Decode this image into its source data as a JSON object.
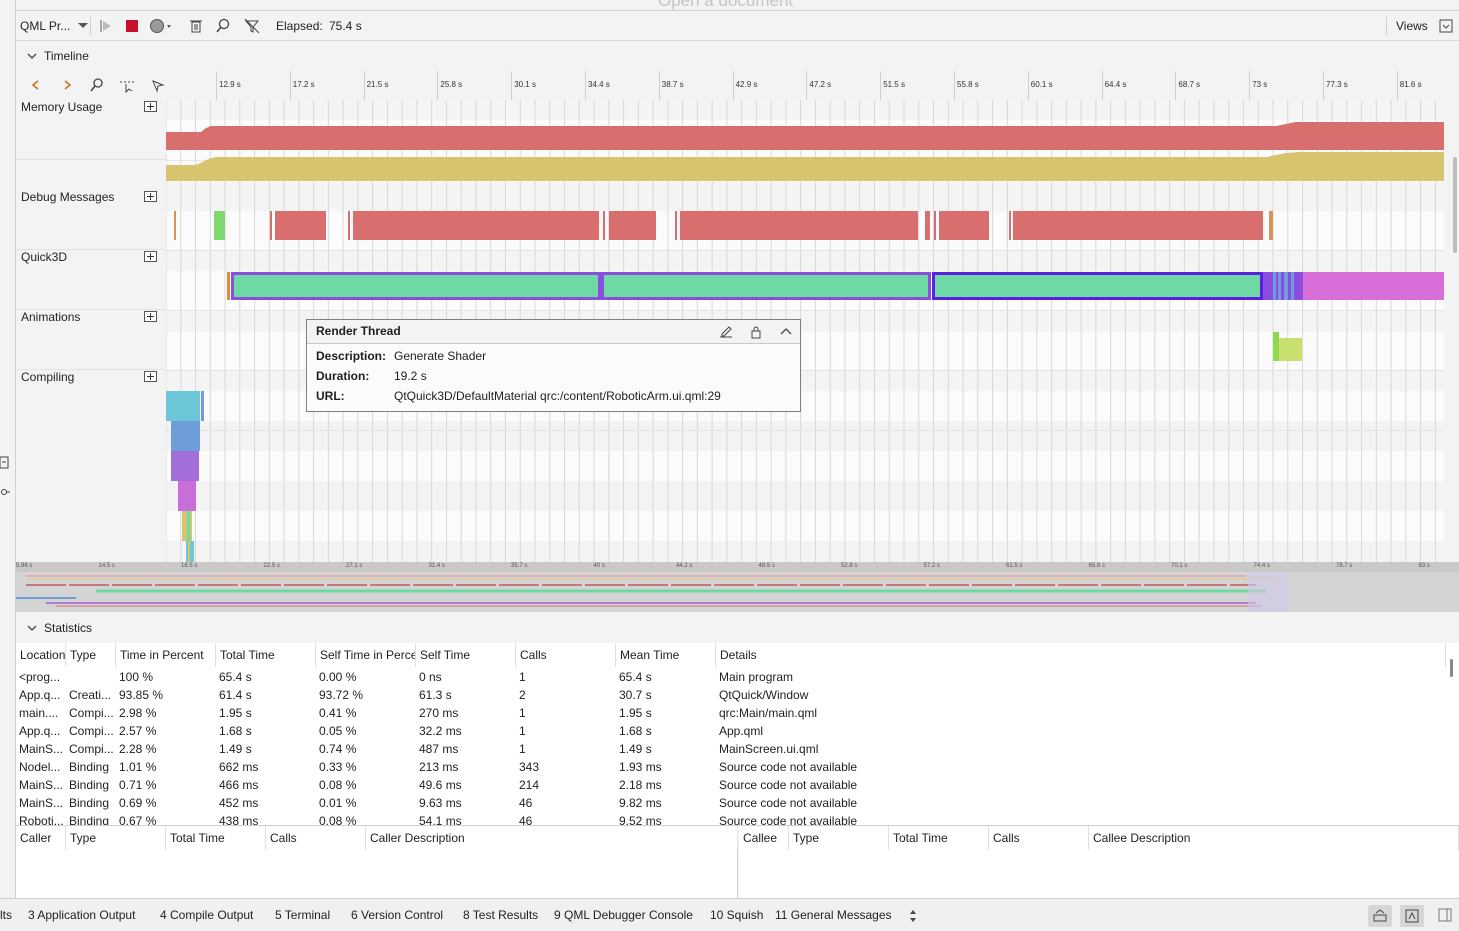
{
  "window": {
    "document_title": "Open a document"
  },
  "toolbar": {
    "profiler_combo": "QML Pr...",
    "elapsed_label": "Elapsed:",
    "elapsed_value": "75.4 s",
    "views_label": "Views"
  },
  "timeline": {
    "section_title": "Timeline",
    "ticks": [
      "12.9 s",
      "17.2 s",
      "21.5 s",
      "25.8 s",
      "30.1 s",
      "34.4 s",
      "38.7 s",
      "42.9 s",
      "47.2 s",
      "51.5 s",
      "55.8 s",
      "60.1 s",
      "64.4 s",
      "68.7 s",
      "73 s",
      "77.3 s",
      "81.6 s"
    ],
    "categories": [
      "Memory Usage",
      "Debug Messages",
      "Quick3D",
      "Animations",
      "Compiling"
    ],
    "overview_ticks": [
      "5.96 s",
      "14.5 s",
      "18.5 s",
      "22.5 s",
      "27.1 s",
      "31.4 s",
      "35.7 s",
      "40 s",
      "44.2 s",
      "48.5 s",
      "52.8 s",
      "57.2 s",
      "61.5 s",
      "65.8 s",
      "70.1 s",
      "74.4 s",
      "78.7 s",
      "83 s"
    ]
  },
  "tooltip": {
    "title": "Render Thread",
    "description_label": "Description:",
    "description_value": "Generate Shader",
    "duration_label": "Duration:",
    "duration_value": "19.2 s",
    "url_label": "URL:",
    "url_value": "QtQuick3D/DefaultMaterial qrc:/content/RoboticArm.ui.qml:29"
  },
  "statistics": {
    "section_title": "Statistics",
    "columns": [
      "Location",
      "Type",
      "Time in Percent",
      "Total Time",
      "Self Time in Percent",
      "Self Time",
      "Calls",
      "Mean Time",
      "Details"
    ],
    "rows": [
      [
        "<prog...",
        "",
        "100 %",
        "65.4 s",
        "0.00 %",
        "0 ns",
        "1",
        "65.4 s",
        "Main program"
      ],
      [
        "App.q...",
        "Creati...",
        "93.85 %",
        "61.4 s",
        "93.72 %",
        "61.3 s",
        "2",
        "30.7 s",
        "QtQuick/Window"
      ],
      [
        "main....",
        "Compi...",
        "2.98 %",
        "1.95 s",
        "0.41 %",
        "270 ms",
        "1",
        "1.95 s",
        "qrc:Main/main.qml"
      ],
      [
        "App.q...",
        "Compi...",
        "2.57 %",
        "1.68 s",
        "0.05 %",
        "32.2 ms",
        "1",
        "1.68 s",
        "App.qml"
      ],
      [
        "MainS...",
        "Compi...",
        "2.28 %",
        "1.49 s",
        "0.74 %",
        "487 ms",
        "1",
        "1.49 s",
        "MainScreen.ui.qml"
      ],
      [
        "Nodel...",
        "Binding",
        "1.01 %",
        "662 ms",
        "0.33 %",
        "213 ms",
        "343",
        "1.93 ms",
        "Source code not available"
      ],
      [
        "MainS...",
        "Binding",
        "0.71 %",
        "466 ms",
        "0.08 %",
        "49.6 ms",
        "214",
        "2.18 ms",
        "Source code not available"
      ],
      [
        "MainS...",
        "Binding",
        "0.69 %",
        "452 ms",
        "0.01 %",
        "9.63 ms",
        "46",
        "9.82 ms",
        "Source code not available"
      ],
      [
        "Roboti...",
        "Binding",
        "0.67 %",
        "438 ms",
        "0.08 %",
        "54.1 ms",
        "46",
        "9.52 ms",
        "Source code not available"
      ]
    ]
  },
  "callers": {
    "columns": [
      "Caller",
      "Type",
      "Total Time",
      "Calls",
      "Caller Description"
    ]
  },
  "callees": {
    "columns": [
      "Callee",
      "Type",
      "Total Time",
      "Calls",
      "Callee Description"
    ]
  },
  "bottom_tabs": [
    "lts",
    "3  Application Output",
    "4  Compile Output",
    "5  Terminal",
    "6  Version Control",
    "8  Test Results",
    "9  QML Debugger Console",
    "10  Squish",
    "11  General Messages"
  ],
  "colors": {
    "memory_alloc": "#d86e6e",
    "memory_usage": "#d9c46e",
    "debug": "#d86e6e",
    "quick3d_fill": "#6ed9a4",
    "quick3d_border": "#8a4de0",
    "quick3d_selected_border": "#5c1ee0",
    "animation": "#d84fd8",
    "compile_1": "#6ec6d9",
    "compile_2": "#6e9dd9",
    "compile_3": "#a46ed9"
  }
}
